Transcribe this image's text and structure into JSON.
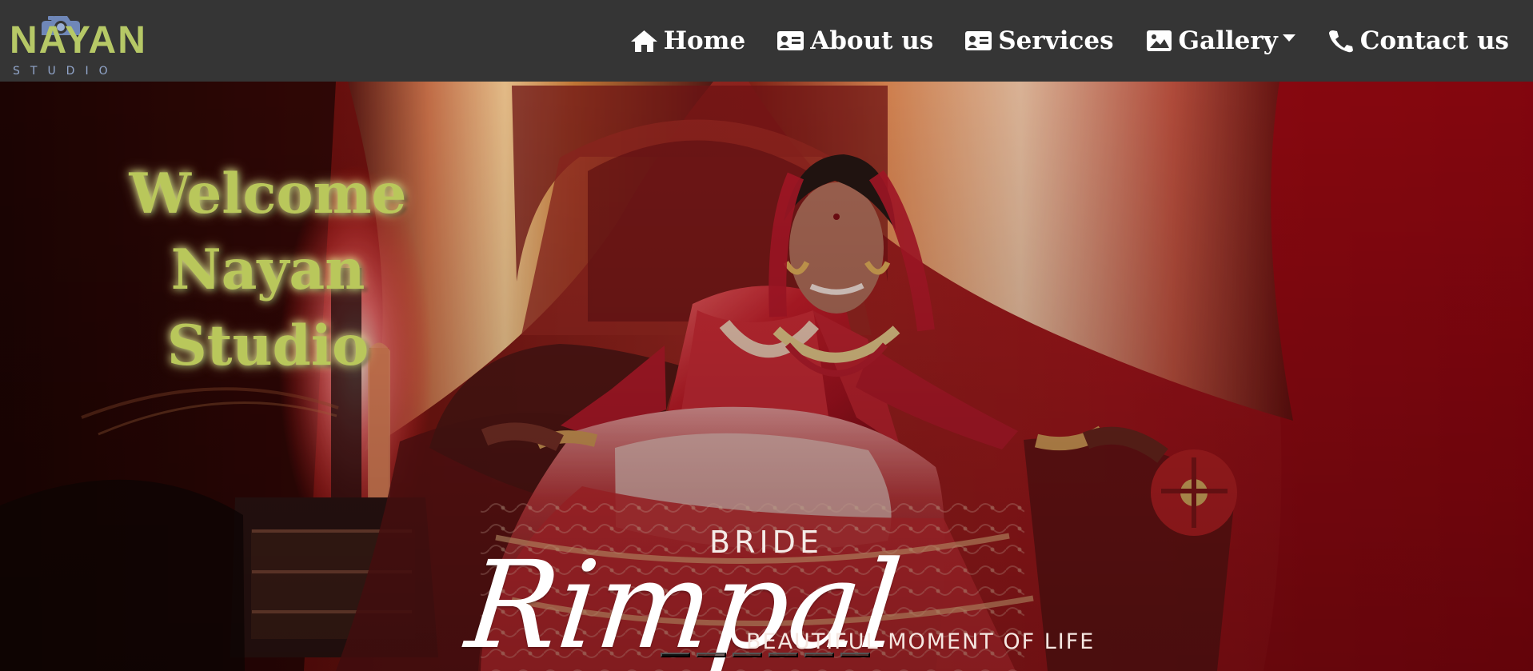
{
  "brand": {
    "name": "NAYAN",
    "subtitle": "STUDIO",
    "camera_icon": "camera-icon"
  },
  "navigation": {
    "items": [
      {
        "label": "Home",
        "icon": "home-icon"
      },
      {
        "label": "About us",
        "icon": "id-card-icon"
      },
      {
        "label": "Services",
        "icon": "id-card-icon"
      },
      {
        "label": "Gallery",
        "icon": "image-icon",
        "dropdown": true
      },
      {
        "label": "Contact us",
        "icon": "phone-icon"
      }
    ]
  },
  "hero": {
    "title_line_1": "Welcome",
    "title_line_2": "Nayan Studio",
    "bride_label": "BRIDE",
    "bride_name": "Rimpal",
    "tagline": "BEAUTIFUL MOMENT OF LIFE"
  },
  "carousel": {
    "slide_count": 6,
    "active_slide": 1
  },
  "colors": {
    "navbar": "#353535",
    "brand_primary": "#b6c866",
    "brand_secondary": "#92a6cb",
    "welcome_text": "#b9c75b",
    "hero_red": "#a90f16"
  }
}
